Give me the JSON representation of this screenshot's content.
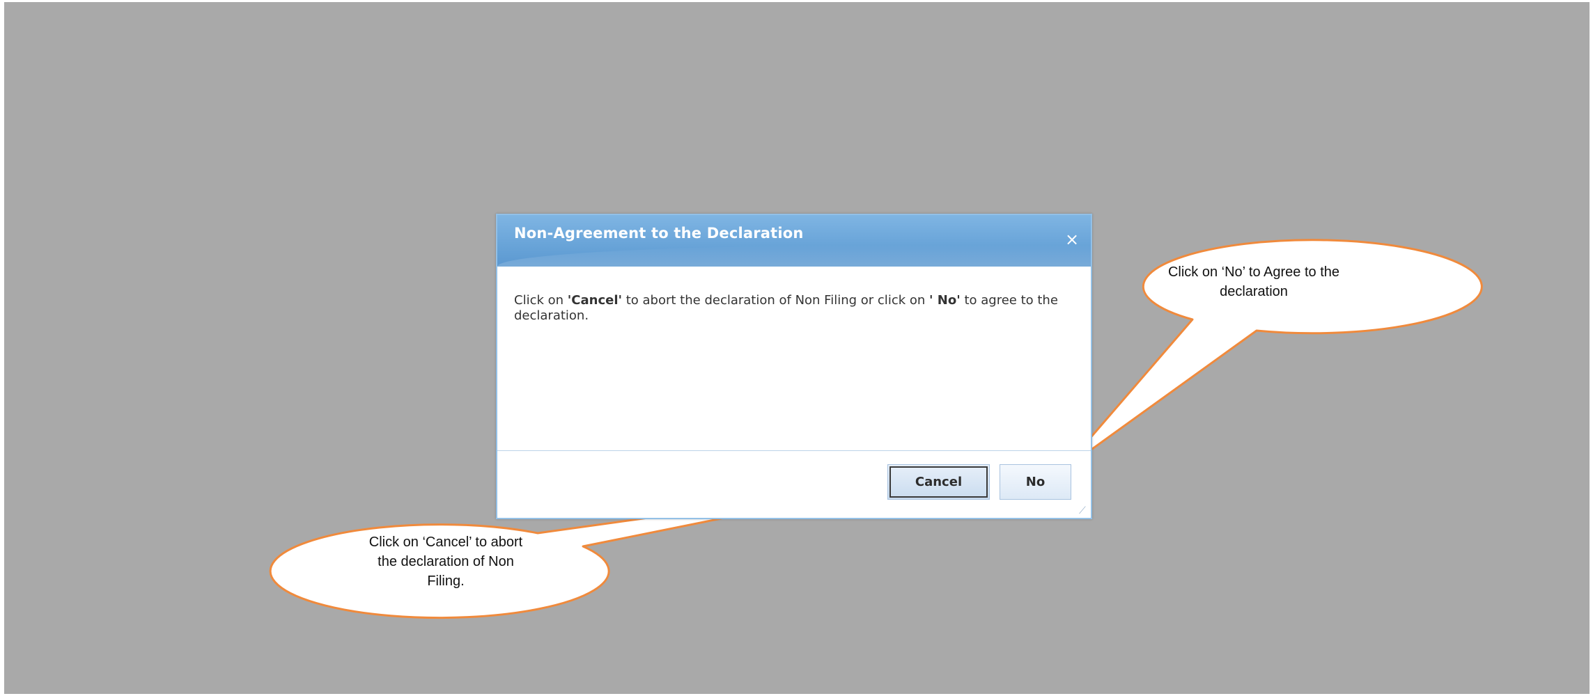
{
  "dialog": {
    "title": "Non-Agreement to the Declaration",
    "close_symbol": "×",
    "message_parts": {
      "p1": "Click on ",
      "cancel_word": "'Cancel'",
      "p2": " to abort the declaration of Non Filing or click on ",
      "no_word": "' No'",
      "p3": " to agree to the declaration."
    },
    "buttons": {
      "cancel": "Cancel",
      "no": "No"
    },
    "resize_symbol": "⟋"
  },
  "callouts": {
    "no": "Click on ‘No’ to Agree to the declaration",
    "cancel": "Click on ‘Cancel’ to abort the declaration of Non Filing."
  },
  "colors": {
    "backdrop": "#a9a9a9",
    "header": "#6aa5d9",
    "callout_border": "#f08a3c"
  }
}
